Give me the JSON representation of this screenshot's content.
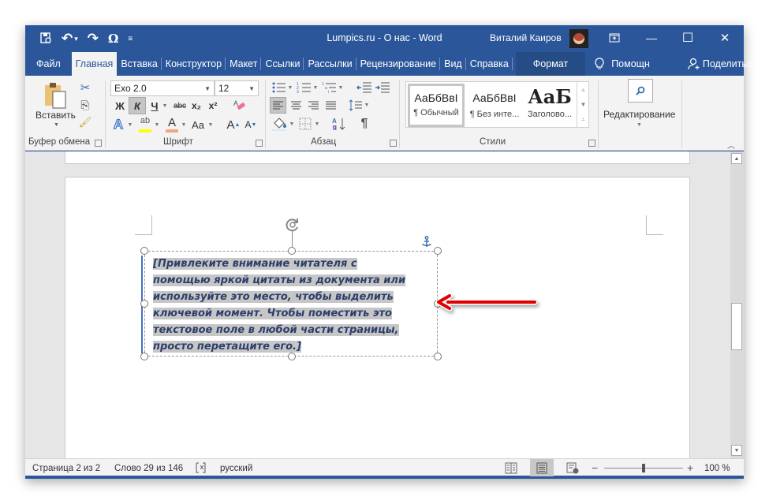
{
  "window": {
    "title": "Lumpics.ru - О нас  -  Word",
    "user_name": "Виталий Каиров",
    "controls": {
      "ribbon_display": "⊡",
      "minimize": "—",
      "maximize": "☐",
      "close": "✕"
    }
  },
  "qat": {
    "save_icon": "🖫",
    "undo": "↶",
    "undo_dd": "▾",
    "redo": "↷",
    "symbol": "Ω",
    "customize": "≡"
  },
  "tabs": [
    {
      "label": "Файл"
    },
    {
      "label": "Главная"
    },
    {
      "label": "Вставка"
    },
    {
      "label": "Конструктор"
    },
    {
      "label": "Макет"
    },
    {
      "label": "Ссылки"
    },
    {
      "label": "Рассылки"
    },
    {
      "label": "Рецензирование"
    },
    {
      "label": "Вид"
    },
    {
      "label": "Справка"
    },
    {
      "label": "Формат"
    }
  ],
  "tell_me": {
    "icon": "💡",
    "label": "Помощн"
  },
  "share": {
    "icon": "👤",
    "label": "Поделиться"
  },
  "ribbon": {
    "clipboard": {
      "label": "Буфер обмена",
      "paste": "Вставить",
      "cut": "✂",
      "copy": "⎘",
      "format_painter": "🖌"
    },
    "font": {
      "label": "Шрифт",
      "font_name": "Exo 2.0",
      "font_size": "12",
      "bold": "Ж",
      "italic": "К",
      "underline": "Ч",
      "strike": "abc",
      "subscript": "x₂",
      "superscript": "x²",
      "clear_format": "A",
      "text_effects": "A",
      "highlight": "ab",
      "font_color": "A",
      "change_case": "Aa",
      "grow": "A",
      "shrink": "A",
      "highlight_color": "#ffff00",
      "font_color_bar": "#f4a582"
    },
    "paragraph": {
      "label": "Абзац",
      "bullets": "☰",
      "numbering": "☰",
      "multilevel": "☰",
      "decrease_indent": "⇤",
      "increase_indent": "⇥",
      "align_left": "≡",
      "align_center": "≡",
      "align_right": "≡",
      "justify": "≡",
      "line_spacing": "↕",
      "shading": "◇",
      "borders": "⊞",
      "sort": "А↓",
      "pilcrow": "¶"
    },
    "styles": {
      "label": "Стили",
      "items": [
        {
          "preview": "АаБбВвІ",
          "name": "¶ Обычный",
          "selected": true
        },
        {
          "preview": "АаБбВвІ",
          "name": "¶ Без инте...",
          "selected": false
        },
        {
          "preview": "АаБ",
          "name": "Заголово...",
          "selected": false
        }
      ]
    },
    "editing": {
      "label": "Редактирование",
      "icon": "⌕"
    }
  },
  "document": {
    "textbox_text": "[Привлеките внимание читателя с помощью яркой цитаты из документа или используйте это место, чтобы выделить ключевой момент. Чтобы поместить это текстовое поле в любой части страницы, просто перетащите его.]",
    "textbox_lines": [
      "[Привлеките внимание читателя с",
      "помощью яркой цитаты из документа или",
      "используйте это место, чтобы выделить",
      "ключевой момент. Чтобы поместить это",
      "текстовое поле в любой части страницы,",
      "просто перетащите его.]"
    ],
    "accent_color": "#4472c4",
    "arrow_color": "#e00000"
  },
  "statusbar": {
    "page": "Страница 2 из 2",
    "words": "Слово 29 из 146",
    "proofing_icon": "📖",
    "language": "русский",
    "zoom_minus": "−",
    "zoom_plus": "+",
    "zoom_level": "100 %",
    "zoom_value_percent": 100
  }
}
